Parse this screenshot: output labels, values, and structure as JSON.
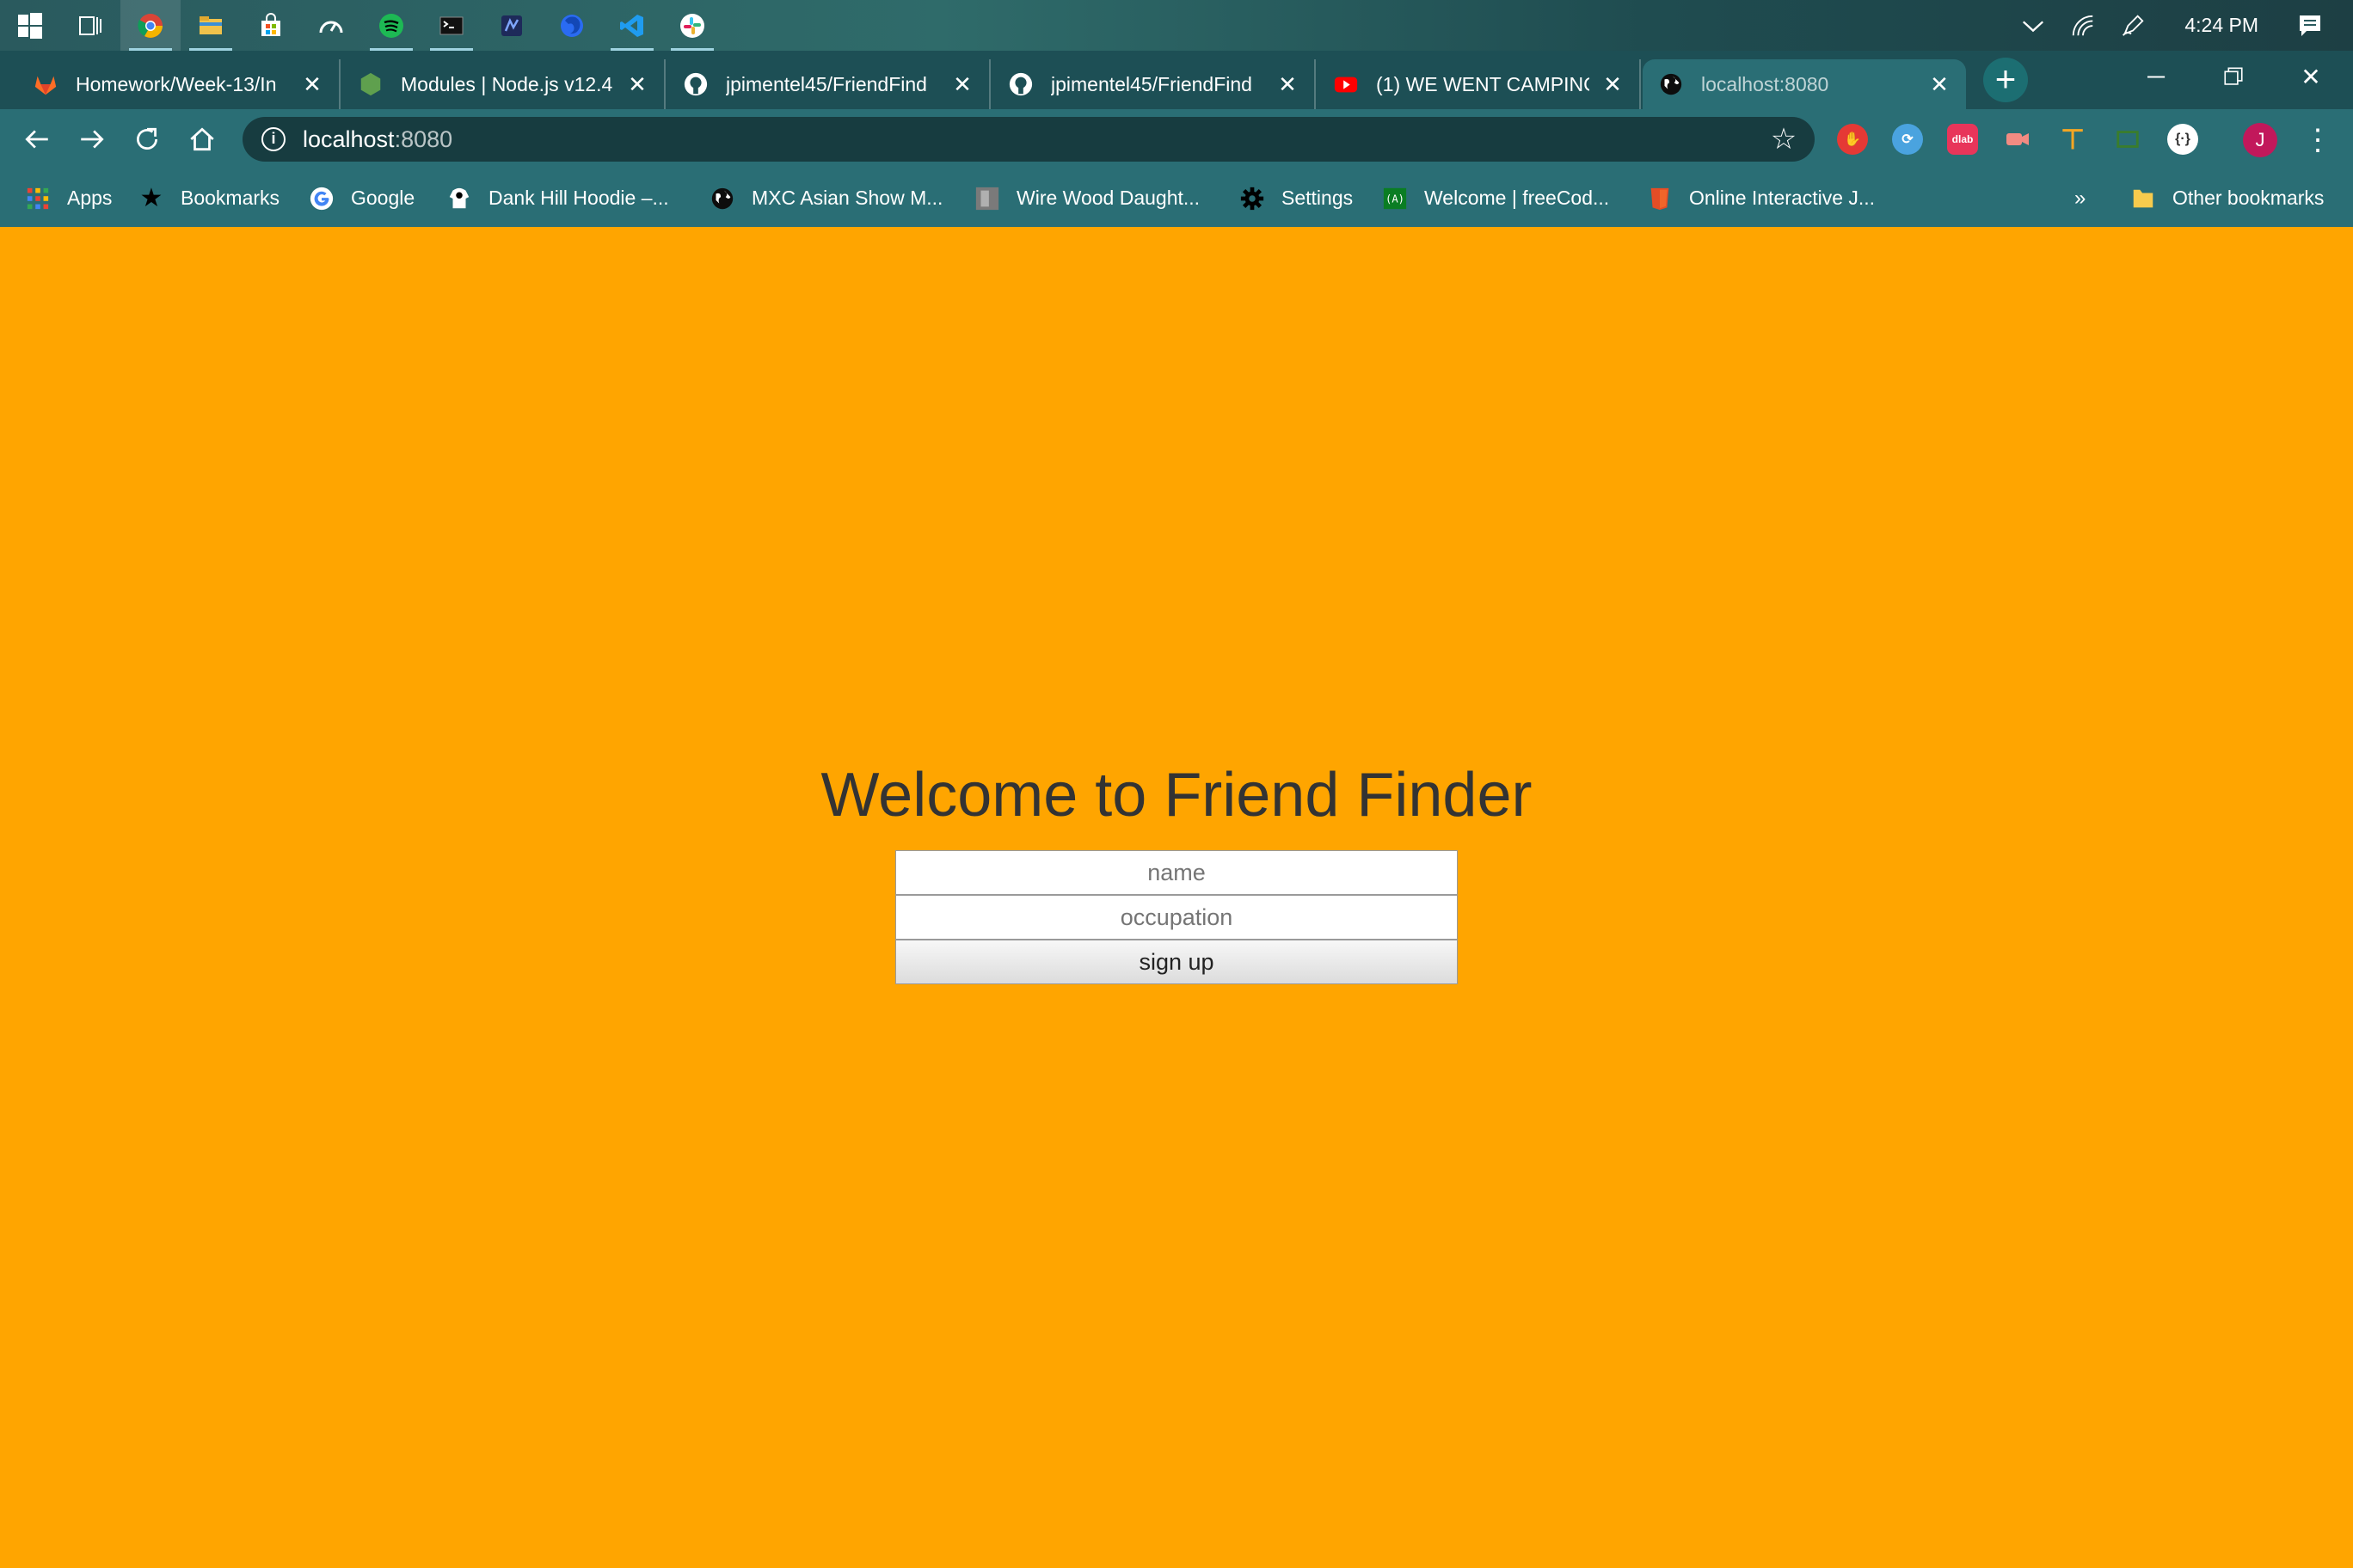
{
  "taskbar": {
    "apps": [
      {
        "icon": "windows-start-icon"
      },
      {
        "icon": "task-view-icon"
      },
      {
        "icon": "chrome-icon",
        "active": true
      },
      {
        "icon": "file-explorer-icon"
      },
      {
        "icon": "store-icon"
      },
      {
        "icon": "speedometer-icon"
      },
      {
        "icon": "spotify-icon"
      },
      {
        "icon": "terminal-icon"
      },
      {
        "icon": "dev-tool-icon"
      },
      {
        "icon": "firefox-icon"
      },
      {
        "icon": "vscode-icon"
      },
      {
        "icon": "slack-icon"
      }
    ],
    "clock": "4:24 PM"
  },
  "tabs": [
    {
      "title": "Homework/Week-13/In",
      "favicon": "gitlab-icon"
    },
    {
      "title": "Modules | Node.js v12.4",
      "favicon": "nodejs-icon"
    },
    {
      "title": "jpimentel45/FriendFind",
      "favicon": "github-icon"
    },
    {
      "title": "jpimentel45/FriendFind",
      "favicon": "github-icon"
    },
    {
      "title": "(1) WE WENT CAMPING",
      "favicon": "youtube-icon"
    },
    {
      "title": "localhost:8080",
      "favicon": "globe-icon",
      "active": true
    }
  ],
  "address_bar": {
    "host": "localhost",
    "port": ":8080"
  },
  "avatar_initial": "J",
  "bookmarks": [
    {
      "label": "Apps",
      "icon": "apps-grid-icon"
    },
    {
      "label": "Bookmarks",
      "icon": "star-icon"
    },
    {
      "label": "Google",
      "icon": "google-icon"
    },
    {
      "label": "Dank Hill Hoodie –...",
      "icon": "hoodie-icon"
    },
    {
      "label": "MXC Asian Show M...",
      "icon": "globe-icon"
    },
    {
      "label": "Wire Wood Daught...",
      "icon": "image-icon"
    },
    {
      "label": "Settings",
      "icon": "gear-icon"
    },
    {
      "label": "Welcome | freeCod...",
      "icon": "freecodecamp-icon"
    },
    {
      "label": "Online Interactive J...",
      "icon": "html5-icon"
    }
  ],
  "bookmarks_overflow": "»",
  "other_bookmarks": "Other bookmarks",
  "page": {
    "heading": "Welcome to Friend Finder",
    "name_placeholder": "name",
    "occupation_placeholder": "occupation",
    "signup_label": "sign up",
    "background": "#FFA500"
  }
}
